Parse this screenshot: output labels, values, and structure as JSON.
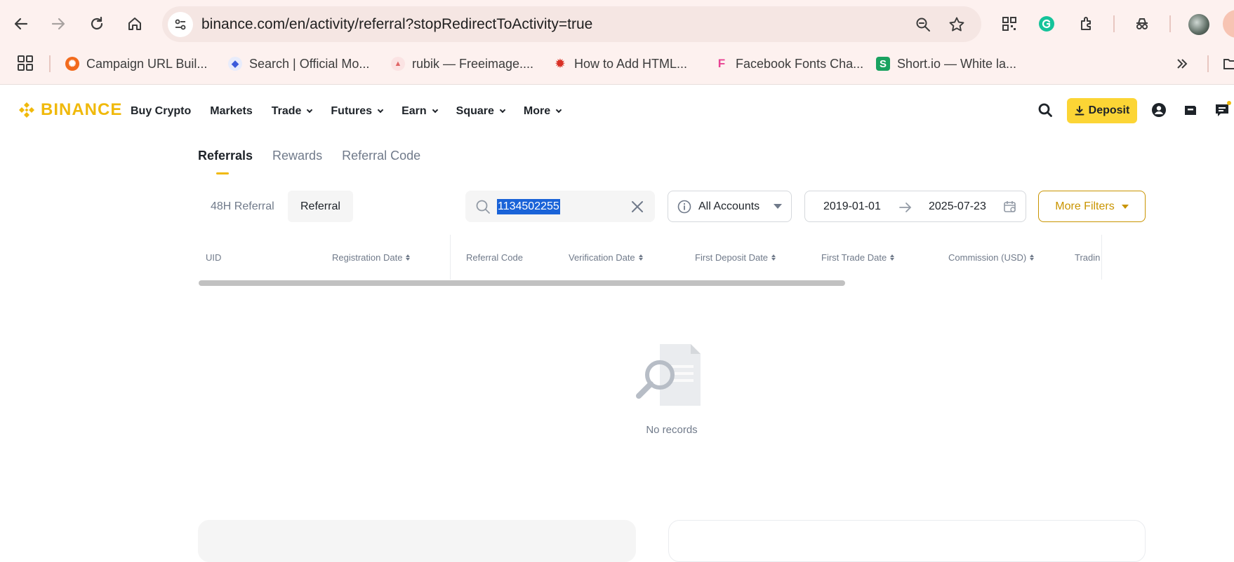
{
  "browser": {
    "url": "binance.com/en/activity/referral?stopRedirectToActivity=true",
    "bookmarks": [
      {
        "label": "Campaign URL Buil...",
        "icon": "campaign-favicon",
        "color": "#f26b1d"
      },
      {
        "label": "Search | Official Mo...",
        "icon": "search-favicon",
        "color": "#3b5bdb"
      },
      {
        "label": "rubik — Freeimage....",
        "icon": "freeimage-favicon",
        "color": "#e06666"
      },
      {
        "label": "How to Add HTML...",
        "icon": "html-favicon",
        "color": "#d93025"
      },
      {
        "label": "Facebook Fonts Cha...",
        "icon": "facebook-fonts-favicon",
        "color": "#e84393"
      },
      {
        "label": "Short.io — White la...",
        "icon": "shortio-favicon",
        "color": "#1aa260"
      }
    ]
  },
  "header": {
    "logo": "BINANCE",
    "menu": [
      "Buy Crypto",
      "Markets",
      "Trade",
      "Futures",
      "Earn",
      "Square",
      "More"
    ],
    "deposit_label": "Deposit"
  },
  "tabs": [
    "Referrals",
    "Rewards",
    "Referral Code"
  ],
  "filters": {
    "segment_48h": "48H Referral",
    "segment_referral": "Referral",
    "search_value": "1134502255",
    "accounts": "All Accounts",
    "date_from": "2019-01-01",
    "date_to": "2025-07-23",
    "more_filters": "More Filters"
  },
  "table": {
    "columns": [
      "UID",
      "Registration Date",
      "Referral Code",
      "Verification Date",
      "First Deposit Date",
      "First Trade Date",
      "Commission (USD)",
      "Tradin"
    ]
  },
  "empty_state": "No records",
  "colors": {
    "brand": "#f0b90b",
    "deposit": "#fcd535",
    "accent_text": "#c99400"
  }
}
